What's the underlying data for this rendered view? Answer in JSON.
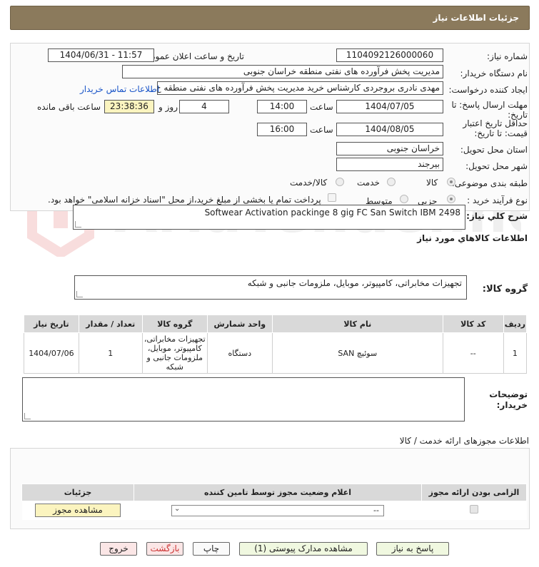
{
  "header": {
    "title": "جزئیات اطلاعات نیاز"
  },
  "form": {
    "need_number_label": "شماره نیاز:",
    "need_number": "1104092126000060",
    "announce_label": "تاریخ و ساعت اعلان عمومی:",
    "announce_value": "1404/06/31 - 11:57",
    "buyer_label": "نام دستگاه خریدار:",
    "buyer_value": "مدیریت پخش فرآورده های نفتی منطقه خراسان جنوبی",
    "creator_label": "ایجاد کننده درخواست:",
    "creator_value": "مهدی نادری بروجردی کارشناس خرید مدیریت پخش فرآورده های نفتی منطقه خ",
    "contact_link": "اطلاعات تماس خریدار",
    "deadline_label": "مهلت ارسال پاسخ: تا تاریخ:",
    "deadline_date": "1404/07/05",
    "time_label": "ساعت",
    "deadline_time": "14:00",
    "days": "4",
    "days_label": "روز و",
    "remaining": "23:38:36",
    "remaining_label": "ساعت باقی مانده",
    "validity_label": "حداقل تاریخ اعتبار قیمت: تا تاریخ:",
    "validity_date": "1404/08/05",
    "validity_time_label": "ساعت",
    "validity_time": "16:00",
    "province_label": "استان محل تحویل:",
    "province_value": "خراسان جنوبی",
    "city_label": "شهر محل تحویل:",
    "city_value": "بیرجند",
    "category_label": "طبقه بندی موضوعی:",
    "category_options": [
      "کالا",
      "خدمت",
      "کالا/خدمت"
    ],
    "purchase_label": "نوع فرآیند خرید :",
    "purchase_options": [
      "جزیی",
      "متوسط"
    ],
    "payment_note": "پرداخت تمام یا بخشی از مبلغ خرید،از محل \"اسناد خزانه اسلامی\" خواهد بود."
  },
  "summary": {
    "label": "شرح کلي نياز:",
    "value": "Softwear Activation packinge 8 gig FC San Switch IBM 2498"
  },
  "goods": {
    "section_title": "اطلاعات کالاهاي مورد نياز",
    "group_label": "گروه کالا:",
    "group_value": "تجهیزات مخابراتی، کامپیوتر، موبایل، ملزومات جانبی و شبکه",
    "columns": [
      "ردیف",
      "کد کالا",
      "نام کالا",
      "واحد شمارش",
      "گروه کالا",
      "تعداد / مقدار",
      "تاریخ نیاز"
    ],
    "rows": [
      [
        "1",
        "--",
        "سوئیچ SAN",
        "دستگاه",
        "تجهیزات مخابراتی، کامپیوتر، موبایل، ملزومات جانبی و شبکه",
        "1",
        "1404/07/06"
      ]
    ]
  },
  "notes": {
    "label": "توضیحات خریدار:"
  },
  "licenses": {
    "title": "اطلاعات مجوزهای ارائه خدمت / کالا",
    "columns": [
      "الزامی بودن ارائه مجوز",
      "اعلام وضعیت مجوز توسط تامین کننده",
      "جزئیات"
    ],
    "select_value": "--",
    "view_button": "مشاهده مجوز"
  },
  "buttons": {
    "reply": "پاسخ به نیاز",
    "docs": "مشاهده مدارک پیوستی (1)",
    "print": "چاپ",
    "back": "بازگشت",
    "exit": "خروج"
  }
}
